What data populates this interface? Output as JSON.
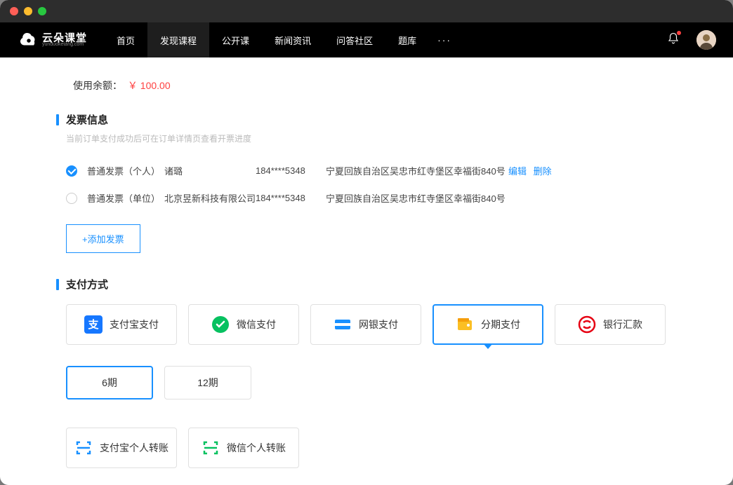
{
  "brand": {
    "name": "云朵课堂",
    "sub": "yunduoketang.com"
  },
  "nav": {
    "items": [
      {
        "label": "首页"
      },
      {
        "label": "发现课程"
      },
      {
        "label": "公开课"
      },
      {
        "label": "新闻资讯"
      },
      {
        "label": "问答社区"
      },
      {
        "label": "题库"
      }
    ],
    "active_index": 1
  },
  "balance": {
    "label": "使用余额：",
    "amount": "￥ 100.00"
  },
  "invoice": {
    "title": "发票信息",
    "hint": "当前订单支付成功后可在订单详情页查看开票进度",
    "rows": [
      {
        "type": "普通发票（个人）",
        "name": "诸璐",
        "phone": "184****5348",
        "addr": "宁夏回族自治区吴忠市红寺堡区幸福街840号",
        "checked": true,
        "actions": true
      },
      {
        "type": "普通发票（单位）",
        "name": "北京昱新科技有限公司",
        "phone": "184****5348",
        "addr": "宁夏回族自治区吴忠市红寺堡区幸福街840号",
        "checked": false,
        "actions": false
      }
    ],
    "edit_label": "编辑",
    "delete_label": "删除",
    "add_label": "+添加发票"
  },
  "payment": {
    "title": "支付方式",
    "methods": [
      {
        "label": "支付宝支付",
        "icon": "alipay"
      },
      {
        "label": "微信支付",
        "icon": "wechat"
      },
      {
        "label": "网银支付",
        "icon": "bank"
      },
      {
        "label": "分期支付",
        "icon": "wallet"
      },
      {
        "label": "银行汇款",
        "icon": "bankwire"
      }
    ],
    "selected_index": 3,
    "installments": [
      {
        "label": "6期",
        "selected": true
      },
      {
        "label": "12期",
        "selected": false
      }
    ],
    "transfers": [
      {
        "label": "支付宝个人转账",
        "icon": "scan-blue"
      },
      {
        "label": "微信个人转账",
        "icon": "scan-green"
      }
    ]
  }
}
